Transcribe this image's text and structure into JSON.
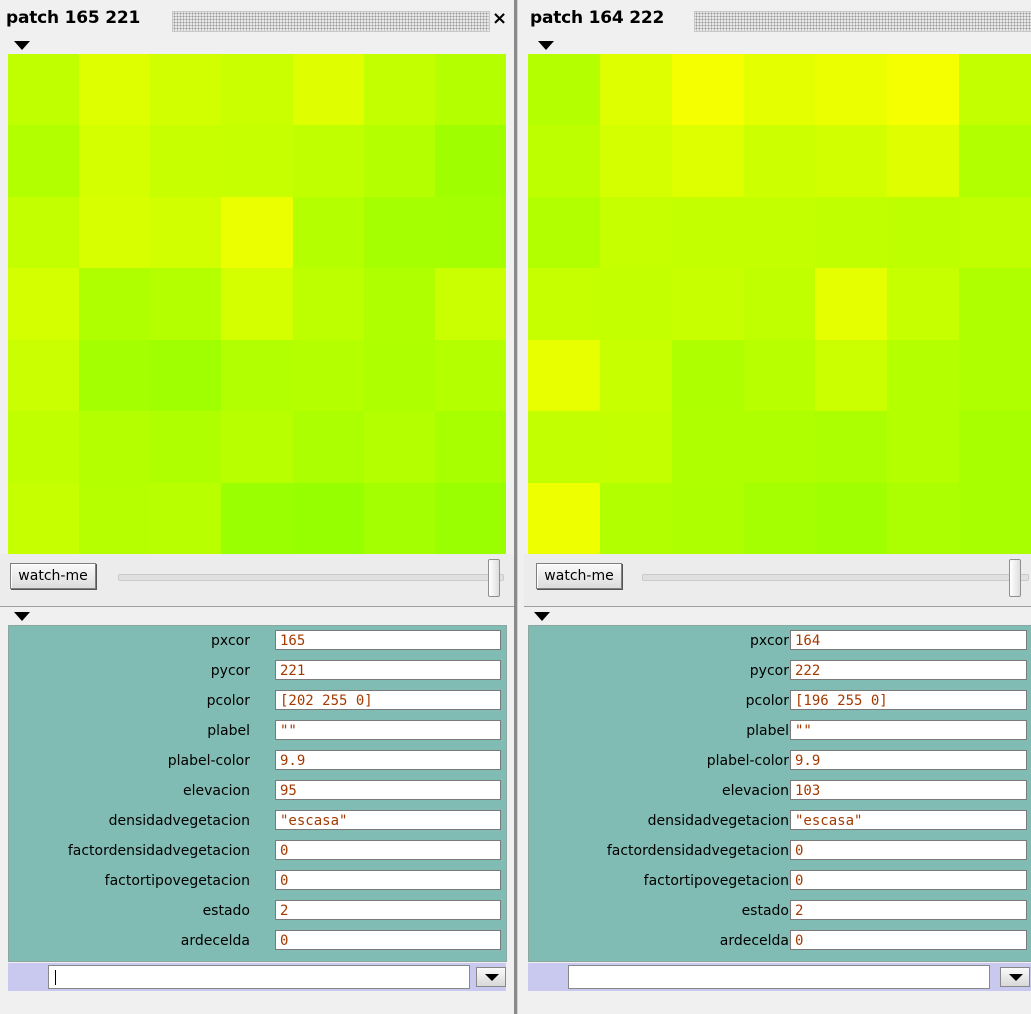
{
  "panels": [
    {
      "title": "patch 165 221",
      "watch_button": "watch-me",
      "zoom_level": 1.0,
      "patch_grid": [
        [
          "#bfff00",
          "#ddff00",
          "#d2ff00",
          "#caff00",
          "#dfff00",
          "#c4ff00",
          "#b4ff00"
        ],
        [
          "#b2ff00",
          "#d4ff00",
          "#c8ff00",
          "#c6ff00",
          "#c0ff00",
          "#b4ff00",
          "#9fff00"
        ],
        [
          "#c4ff00",
          "#d7ff00",
          "#d2ff00",
          "#ebff00",
          "#b4ff00",
          "#a5ff00",
          "#a4ff00"
        ],
        [
          "#d4ff00",
          "#afff00",
          "#b4ff00",
          "#d4ff00",
          "#beff00",
          "#afff00",
          "#c9ff00"
        ],
        [
          "#c9ff00",
          "#a4ff00",
          "#a0ff00",
          "#b1ff00",
          "#b4ff00",
          "#aeff00",
          "#b4ff00"
        ],
        [
          "#bfff00",
          "#b4ff00",
          "#b0ff00",
          "#b8ff00",
          "#acff00",
          "#b4ff00",
          "#a8ff00"
        ],
        [
          "#c6ff00",
          "#b6ff00",
          "#b8ff00",
          "#9aff00",
          "#96ff00",
          "#a4ff00",
          "#9aff00"
        ]
      ],
      "properties": [
        {
          "name": "pxcor",
          "value": "165"
        },
        {
          "name": "pycor",
          "value": "221"
        },
        {
          "name": "pcolor",
          "value": "[202 255 0]"
        },
        {
          "name": "plabel",
          "value": "\"\""
        },
        {
          "name": "plabel-color",
          "value": "9.9"
        },
        {
          "name": "elevacion",
          "value": "95"
        },
        {
          "name": "densidadvegetacion",
          "value": "\"escasa\""
        },
        {
          "name": "factordensidadvegetacion",
          "value": "0"
        },
        {
          "name": "factortipovegetacion",
          "value": "0"
        },
        {
          "name": "estado",
          "value": "2"
        },
        {
          "name": "ardecelda",
          "value": "0"
        }
      ],
      "command_input": ""
    },
    {
      "title": "patch 164 222",
      "watch_button": "watch-me",
      "zoom_level": 1.0,
      "patch_grid": [
        [
          "#b4ff00",
          "#ddff00",
          "#f6ff00",
          "#e4ff00",
          "#ecff00",
          "#f6ff00",
          "#c4ff00"
        ],
        [
          "#beff00",
          "#d4ff00",
          "#ddff00",
          "#ccff00",
          "#d2ff00",
          "#dfff00",
          "#b2ff00"
        ],
        [
          "#b2ff00",
          "#c6ff00",
          "#c4ff00",
          "#c4ff00",
          "#c0ff00",
          "#beff00",
          "#bfff00"
        ],
        [
          "#c6ff00",
          "#c4ff00",
          "#c8ff00",
          "#c0ff00",
          "#e5ff00",
          "#c5ff00",
          "#b0ff00"
        ],
        [
          "#e8ff00",
          "#c8ff00",
          "#aeff00",
          "#b8ff00",
          "#cbff00",
          "#b4ff00",
          "#b0ff00"
        ],
        [
          "#c2ff00",
          "#c4ff00",
          "#b0ff00",
          "#b0ff00",
          "#acff00",
          "#b4ff00",
          "#a8ff00"
        ],
        [
          "#eeff00",
          "#b2ff00",
          "#aeff00",
          "#a6ff00",
          "#a0ff00",
          "#acff00",
          "#a8ff00"
        ]
      ],
      "properties": [
        {
          "name": "pxcor",
          "value": "164"
        },
        {
          "name": "pycor",
          "value": "222"
        },
        {
          "name": "pcolor",
          "value": "[196 255 0]"
        },
        {
          "name": "plabel",
          "value": "\"\""
        },
        {
          "name": "plabel-color",
          "value": "9.9"
        },
        {
          "name": "elevacion",
          "value": "103"
        },
        {
          "name": "densidadvegetacion",
          "value": "\"escasa\""
        },
        {
          "name": "factordensidadvegetacion",
          "value": "0"
        },
        {
          "name": "factortipovegetacion",
          "value": "0"
        },
        {
          "name": "estado",
          "value": "2"
        },
        {
          "name": "ardecelda",
          "value": "0"
        }
      ],
      "command_input": ""
    }
  ],
  "colors": {
    "properties_background": "#80bcb4",
    "value_text": "#a33a00",
    "command_strip": "#c9c8ef"
  },
  "icons": {
    "close": "close-icon",
    "collapse": "triangle-down-icon",
    "dropdown": "chevron-down-icon"
  }
}
